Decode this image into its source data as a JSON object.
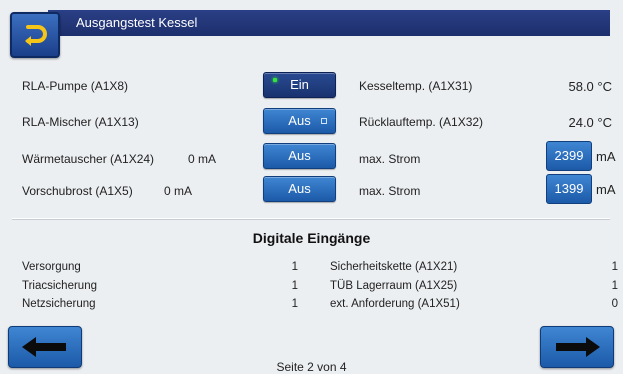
{
  "header": {
    "title": "Ausgangstest Kessel"
  },
  "outputs": [
    {
      "label": "RLA-Pumpe (A1X8)",
      "current": "",
      "button": "Ein"
    },
    {
      "label": "RLA-Mischer (A1X13)",
      "current": "",
      "button": "Aus"
    },
    {
      "label": "Wärmetauscher (A1X24)",
      "current": "0 mA",
      "button": "Aus"
    },
    {
      "label": "Vorschubrost (A1X5)",
      "current": "0 mA",
      "button": "Aus"
    }
  ],
  "measurements": [
    {
      "label": "Kesseltemp. (A1X31)",
      "value": "58.0 °C"
    },
    {
      "label": "Rücklauftemp. (A1X32)",
      "value": "24.0 °C"
    },
    {
      "label": "max. Strom",
      "value": "2399",
      "unit": "mA"
    },
    {
      "label": "max. Strom",
      "value": "1399",
      "unit": "mA"
    }
  ],
  "digital_inputs": {
    "title": "Digitale Eingänge",
    "left": [
      {
        "label": "Versorgung",
        "value": "1"
      },
      {
        "label": "Triacsicherung",
        "value": "1"
      },
      {
        "label": "Netzsicherung",
        "value": "1"
      }
    ],
    "right": [
      {
        "label": "Sicherheitskette (A1X21)",
        "value": "1"
      },
      {
        "label": "TÜB Lagerraum (A1X25)",
        "value": "1"
      },
      {
        "label": "ext. Anforderung (A1X51)",
        "value": "0"
      }
    ]
  },
  "footer": {
    "page": "Seite 2 von 4"
  },
  "icons": {
    "back": "return-arrow-icon",
    "prev": "arrow-left-icon",
    "next": "arrow-right-icon"
  },
  "colors": {
    "header": "#1d2e6c",
    "button": "#2a6fc0",
    "led": "#36e33c",
    "background": "#eceff2"
  }
}
